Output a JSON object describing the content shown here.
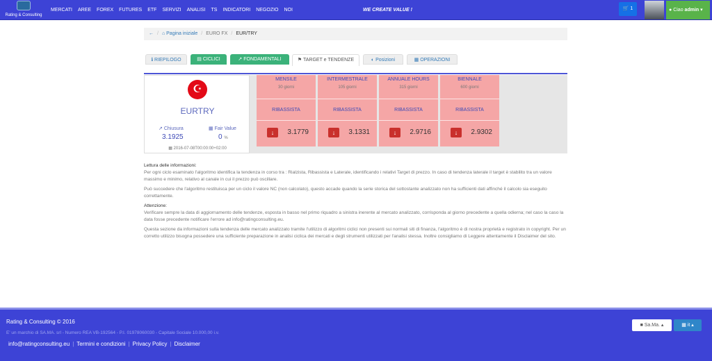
{
  "nav": {
    "brand_text": "Rating & Consulting",
    "items": [
      "MERCATI",
      "AREE",
      "FOREX",
      "FUTURES",
      "ETF",
      "SERVIZI",
      "ANALISI",
      "TS",
      "INDICATORI",
      "NEGOZIO",
      "NOI"
    ],
    "slogan": "WE CREATE VALUE !",
    "cart_count": "1",
    "user_greeting": "Ciao",
    "user_name": "admin"
  },
  "breadcrumb": {
    "home": "Pagina iniziale",
    "section": "EURO FX",
    "current": "EUR/TRY"
  },
  "tabs": [
    {
      "label": "RIEPILOGO",
      "icon": "info-icon"
    },
    {
      "label": "CICLICI",
      "icon": "bar-chart-icon"
    },
    {
      "label": "FONDAMENTALI",
      "icon": "line-chart-icon"
    },
    {
      "label": "TARGET e TENDENZE",
      "icon": "flag-icon"
    },
    {
      "label": "Posizioni",
      "icon": "pie-icon"
    },
    {
      "label": "OPERAZIONI",
      "icon": "calculator-icon"
    }
  ],
  "asset": {
    "name": "EURTRY",
    "chiusura_label": "Chiusura",
    "chiusura_value": "3.1925",
    "fair_label": "Fair Value",
    "fair_value": "0",
    "fair_unit": "%",
    "date": "2016-07-08T00:00:00+02:00"
  },
  "cycles": [
    {
      "title": "MENSILE",
      "sub": "30 giorni",
      "trend": "RIBASSISTA",
      "value": "3.1779"
    },
    {
      "title": "INTERMESTRALE",
      "sub": "105 giorni",
      "trend": "RIBASSISTA",
      "value": "3.1331"
    },
    {
      "title": "ANNUALE HOURS",
      "sub": "315 giorni",
      "trend": "RIBASSISTA",
      "value": "2.9716"
    },
    {
      "title": "BIENNALE",
      "sub": "600 giorni",
      "trend": "RIBASSISTA",
      "value": "2.9302"
    }
  ],
  "info": {
    "h1": "Lettura delle informazioni:",
    "p1": "Per ogni ciclo esaminato l'algoritmo identifica la tendenza in corso tra : Rialzista, Ribassista e Laterale, identificando i relativi Target di prezzo. In caso di tendenza laterale il target è stabilito tra un valore massimo e minimo, relativo al canale in cui il prezzo può oscillare.",
    "p2": "Può succedere che l'algoritmo restituisca per un ciclo il valore NC (non calcolato), questo accade quando la serie storica del sottostante analizzato non ha sufficienti dati affinché il calcolo sia eseguito correttamente.",
    "h2": "Attenzione:",
    "p3": "Verificare sempre la data di aggiornamento delle tendenze, esposta in basso nel primo riquadro a sinistra inerente al mercato analizzato, corrisponda al giorno precedente a quella odierna; nel caso la caso la data fosse precedente notificare l'errore ad info@ratingconsulting.eu.",
    "p4": "Questa sezione da informazioni sulla tendenza delle mercato analizzato tramite l'utilizzo di algoritmi ciclici non presenti sui normali siti di finanza, l'algoritmo è di nostra proprietà e registrato in copyright. Per un corretto utilizzo bisogna possedere una sufficiente preparazione in analisi ciclica dei mercati e degli strumenti utilizzati per l'analisi stessa. Inoltre consigliamo di Leggere attentamente il Disclaimer del sito."
  },
  "footer": {
    "copyright": "Rating & Consulting © 2016",
    "sub": "E' un marchio di SA.MA. srl - Numero REA VB-192564 - P.I. 01978060030 - Capitale Sociale 10.000,00 i.v.",
    "links": [
      "info@ratingconsulting.eu",
      "Termini e condizioni",
      "Privacy Policy",
      "Disclaimer"
    ],
    "sama_label": "Sa.Ma.",
    "lang_label": "it"
  },
  "colors": {
    "navbar": "#3d43d6",
    "tab_green": "#3bb27a",
    "cycle_red": "#f5a6a6",
    "arrow_red": "#c9302c"
  }
}
